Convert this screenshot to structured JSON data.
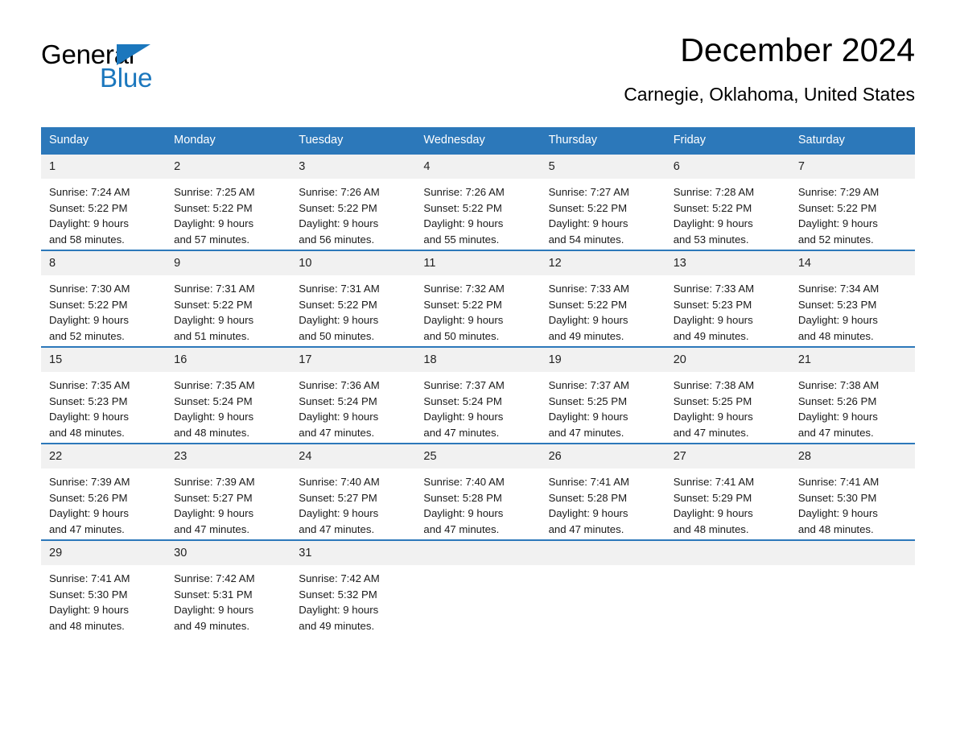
{
  "brand": {
    "name_dark": "General",
    "name_blue": "Blue",
    "accent_color": "#1b77bd"
  },
  "header": {
    "month_title": "December 2024",
    "location": "Carnegie, Oklahoma, United States"
  },
  "theme": {
    "header_blue": "#2c78ba",
    "day_number_bg": "#f1f1f1",
    "text": "#1a1a1a"
  },
  "calendar": {
    "weekdays": [
      "Sunday",
      "Monday",
      "Tuesday",
      "Wednesday",
      "Thursday",
      "Friday",
      "Saturday"
    ],
    "weeks": [
      {
        "days": [
          {
            "number": "1",
            "info": "Sunrise: 7:24 AM\nSunset: 5:22 PM\nDaylight: 9 hours\nand 58 minutes."
          },
          {
            "number": "2",
            "info": "Sunrise: 7:25 AM\nSunset: 5:22 PM\nDaylight: 9 hours\nand 57 minutes."
          },
          {
            "number": "3",
            "info": "Sunrise: 7:26 AM\nSunset: 5:22 PM\nDaylight: 9 hours\nand 56 minutes."
          },
          {
            "number": "4",
            "info": "Sunrise: 7:26 AM\nSunset: 5:22 PM\nDaylight: 9 hours\nand 55 minutes."
          },
          {
            "number": "5",
            "info": "Sunrise: 7:27 AM\nSunset: 5:22 PM\nDaylight: 9 hours\nand 54 minutes."
          },
          {
            "number": "6",
            "info": "Sunrise: 7:28 AM\nSunset: 5:22 PM\nDaylight: 9 hours\nand 53 minutes."
          },
          {
            "number": "7",
            "info": "Sunrise: 7:29 AM\nSunset: 5:22 PM\nDaylight: 9 hours\nand 52 minutes."
          }
        ]
      },
      {
        "days": [
          {
            "number": "8",
            "info": "Sunrise: 7:30 AM\nSunset: 5:22 PM\nDaylight: 9 hours\nand 52 minutes."
          },
          {
            "number": "9",
            "info": "Sunrise: 7:31 AM\nSunset: 5:22 PM\nDaylight: 9 hours\nand 51 minutes."
          },
          {
            "number": "10",
            "info": "Sunrise: 7:31 AM\nSunset: 5:22 PM\nDaylight: 9 hours\nand 50 minutes."
          },
          {
            "number": "11",
            "info": "Sunrise: 7:32 AM\nSunset: 5:22 PM\nDaylight: 9 hours\nand 50 minutes."
          },
          {
            "number": "12",
            "info": "Sunrise: 7:33 AM\nSunset: 5:22 PM\nDaylight: 9 hours\nand 49 minutes."
          },
          {
            "number": "13",
            "info": "Sunrise: 7:33 AM\nSunset: 5:23 PM\nDaylight: 9 hours\nand 49 minutes."
          },
          {
            "number": "14",
            "info": "Sunrise: 7:34 AM\nSunset: 5:23 PM\nDaylight: 9 hours\nand 48 minutes."
          }
        ]
      },
      {
        "days": [
          {
            "number": "15",
            "info": "Sunrise: 7:35 AM\nSunset: 5:23 PM\nDaylight: 9 hours\nand 48 minutes."
          },
          {
            "number": "16",
            "info": "Sunrise: 7:35 AM\nSunset: 5:24 PM\nDaylight: 9 hours\nand 48 minutes."
          },
          {
            "number": "17",
            "info": "Sunrise: 7:36 AM\nSunset: 5:24 PM\nDaylight: 9 hours\nand 47 minutes."
          },
          {
            "number": "18",
            "info": "Sunrise: 7:37 AM\nSunset: 5:24 PM\nDaylight: 9 hours\nand 47 minutes."
          },
          {
            "number": "19",
            "info": "Sunrise: 7:37 AM\nSunset: 5:25 PM\nDaylight: 9 hours\nand 47 minutes."
          },
          {
            "number": "20",
            "info": "Sunrise: 7:38 AM\nSunset: 5:25 PM\nDaylight: 9 hours\nand 47 minutes."
          },
          {
            "number": "21",
            "info": "Sunrise: 7:38 AM\nSunset: 5:26 PM\nDaylight: 9 hours\nand 47 minutes."
          }
        ]
      },
      {
        "days": [
          {
            "number": "22",
            "info": "Sunrise: 7:39 AM\nSunset: 5:26 PM\nDaylight: 9 hours\nand 47 minutes."
          },
          {
            "number": "23",
            "info": "Sunrise: 7:39 AM\nSunset: 5:27 PM\nDaylight: 9 hours\nand 47 minutes."
          },
          {
            "number": "24",
            "info": "Sunrise: 7:40 AM\nSunset: 5:27 PM\nDaylight: 9 hours\nand 47 minutes."
          },
          {
            "number": "25",
            "info": "Sunrise: 7:40 AM\nSunset: 5:28 PM\nDaylight: 9 hours\nand 47 minutes."
          },
          {
            "number": "26",
            "info": "Sunrise: 7:41 AM\nSunset: 5:28 PM\nDaylight: 9 hours\nand 47 minutes."
          },
          {
            "number": "27",
            "info": "Sunrise: 7:41 AM\nSunset: 5:29 PM\nDaylight: 9 hours\nand 48 minutes."
          },
          {
            "number": "28",
            "info": "Sunrise: 7:41 AM\nSunset: 5:30 PM\nDaylight: 9 hours\nand 48 minutes."
          }
        ]
      },
      {
        "days": [
          {
            "number": "29",
            "info": "Sunrise: 7:41 AM\nSunset: 5:30 PM\nDaylight: 9 hours\nand 48 minutes."
          },
          {
            "number": "30",
            "info": "Sunrise: 7:42 AM\nSunset: 5:31 PM\nDaylight: 9 hours\nand 49 minutes."
          },
          {
            "number": "31",
            "info": "Sunrise: 7:42 AM\nSunset: 5:32 PM\nDaylight: 9 hours\nand 49 minutes."
          },
          {
            "number": "",
            "info": ""
          },
          {
            "number": "",
            "info": ""
          },
          {
            "number": "",
            "info": ""
          },
          {
            "number": "",
            "info": ""
          }
        ]
      }
    ]
  }
}
